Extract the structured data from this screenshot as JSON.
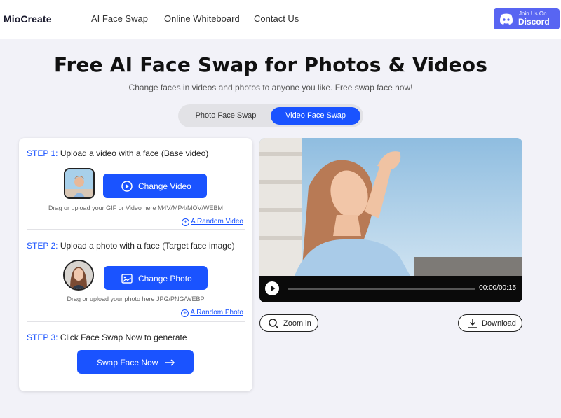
{
  "header": {
    "logo": "MioCreate",
    "nav": [
      "AI Face Swap",
      "Online Whiteboard",
      "Contact Us"
    ],
    "discord": {
      "small": "Join Us On",
      "big": "Discord"
    }
  },
  "hero": {
    "title": "Free AI Face Swap for Photos & Videos",
    "subtitle": "Change faces in videos and photos to anyone you like. Free swap face now!"
  },
  "tabs": {
    "photo": "Photo Face Swap",
    "video": "Video Face Swap",
    "active": "video"
  },
  "steps": {
    "step1": {
      "label": "STEP 1:",
      "text": "Upload a video with a face (Base video)",
      "button": "Change Video",
      "hint": "Drag or upload your GIF or Video here M4V/MP4/MOV/WEBM",
      "random": "A Random Video"
    },
    "step2": {
      "label": "STEP 2:",
      "text": "Upload a photo with a face (Target face image)",
      "button": "Change Photo",
      "hint": "Drag or upload your photo here JPG/PNG/WEBP",
      "random": "A Random Photo"
    },
    "step3": {
      "label": "STEP 3:",
      "text": "Click Face Swap Now to generate",
      "button": "Swap Face Now"
    }
  },
  "player": {
    "time": "00:00/00:15",
    "progress": 0.0
  },
  "actions": {
    "zoom": "Zoom in",
    "download": "Download"
  },
  "colors": {
    "accent": "#1a53ff",
    "discord": "#5865f2",
    "background": "#f2f2f8"
  },
  "icons": {
    "discord": "discord-icon",
    "video_button": "play-circle-icon",
    "photo_button": "image-icon",
    "swap_button": "arrow-right-icon",
    "zoom": "magnifier-icon",
    "download": "download-icon"
  }
}
